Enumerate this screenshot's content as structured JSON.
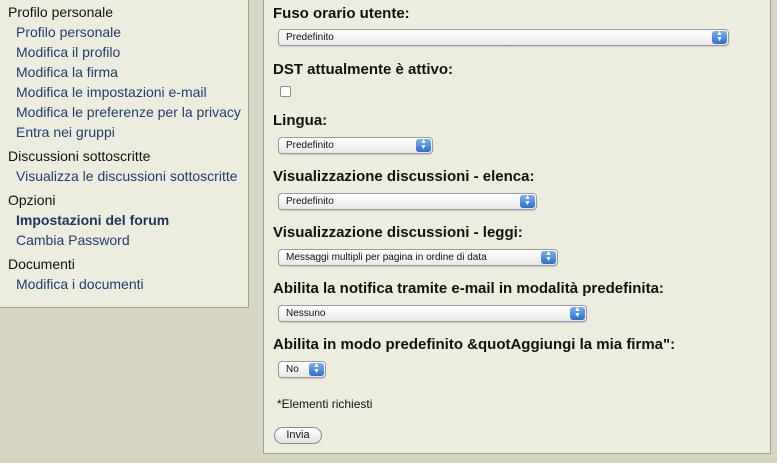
{
  "sidebar": {
    "groups": [
      {
        "title": "Profilo personale",
        "items": [
          "Profilo personale",
          "Modifica il profilo",
          "Modifica la firma",
          "Modifica le impostazioni e-mail",
          "Modifica le preferenze per la privacy",
          "Entra nei gruppi"
        ]
      },
      {
        "title": "Discussioni sottoscritte",
        "items": [
          "Visualizza le discussioni sottoscritte"
        ]
      },
      {
        "title": "Opzioni",
        "items": [
          "Impostazioni del forum",
          "Cambia Password"
        ]
      },
      {
        "title": "Documenti",
        "items": [
          "Modifica i documenti"
        ]
      }
    ],
    "active_item": "Impostazioni del forum"
  },
  "form": {
    "timezone": {
      "label": "Fuso orario utente:",
      "value": "Predefinito"
    },
    "dst": {
      "label": "DST attualmente è attivo:",
      "checked": false
    },
    "language": {
      "label": "Lingua:",
      "value": "Predefinito"
    },
    "thread_list": {
      "label": "Visualizzazione discussioni - elenca:",
      "value": "Predefinito"
    },
    "thread_read": {
      "label": "Visualizzazione discussioni - leggi:",
      "value": "Messaggi multipli per pagina in ordine di data"
    },
    "email_notify": {
      "label": "Abilita la notifica tramite e-mail in modalità predefinita:",
      "value": "Nessuno"
    },
    "signature": {
      "label": "Abilita in modo predefinito &quotAggiungi la mia firma\":",
      "value": "No"
    },
    "required_note": "*Elementi richiesti",
    "submit_label": "Invia"
  },
  "colors": {
    "page_bg": "#d6d6c3",
    "panel_bg": "#ededdf",
    "link": "#1d3e6e",
    "select_arrow": "#2a6fd0"
  }
}
